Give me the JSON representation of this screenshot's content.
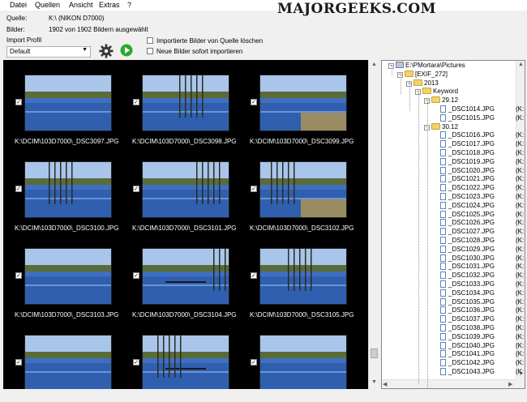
{
  "menu": [
    "Datei",
    "Quellen",
    "Ansicht",
    "Extras",
    "?"
  ],
  "watermark": "MAJORGEEKS.COM",
  "info": {
    "source_label": "Quelle:",
    "source_value": "K:\\ (NIKON D7000)",
    "images_label": "Bilder:",
    "images_value": "1902 von 1902 Bildern ausgewählt",
    "profile_label": "Import Profil",
    "profile_value": "Default"
  },
  "options": {
    "delete_label": "Importierte Bilder von Quelle löschen",
    "import_label": "Neue Bilder sofort importieren"
  },
  "thumbnails": [
    {
      "label": "K:\\DCIM\\103D7000\\_DSC3097.JPG",
      "checked": true
    },
    {
      "label": "K:\\DCIM\\103D7000\\_DSC3098.JPG",
      "checked": true
    },
    {
      "label": "K:\\DCIM\\103D7000\\_DSC3099.JPG",
      "checked": true
    },
    {
      "label": "K:\\DCIM\\103D7000\\_DSC3100.JPG",
      "checked": true
    },
    {
      "label": "K:\\DCIM\\103D7000\\_DSC3101.JPG",
      "checked": true
    },
    {
      "label": "K:\\DCIM\\103D7000\\_DSC3102.JPG",
      "checked": true
    },
    {
      "label": "K:\\DCIM\\103D7000\\_DSC3103.JPG",
      "checked": true
    },
    {
      "label": "K:\\DCIM\\103D7000\\_DSC3104.JPG",
      "checked": true
    },
    {
      "label": "K:\\DCIM\\103D7000\\_DSC3105.JPG",
      "checked": true
    },
    {
      "label": "",
      "checked": true
    },
    {
      "label": "",
      "checked": true
    },
    {
      "label": "",
      "checked": true
    }
  ],
  "tree": {
    "root": "E:\\PMortara\\Pictures",
    "exif": "[EXIF_272]",
    "year": "2013",
    "keyword": "Keyword",
    "date1": "29.12",
    "date2": "30.12",
    "files_date1": [
      "_DSC1014.JPG",
      "_DSC1015.JPG"
    ],
    "files_date2": [
      "_DSC1016.JPG",
      "_DSC1017.JPG",
      "_DSC1018.JPG",
      "_DSC1019.JPG",
      "_DSC1020.JPG",
      "_DSC1021.JPG",
      "_DSC1022.JPG",
      "_DSC1023.JPG",
      "_DSC1024.JPG",
      "_DSC1025.JPG",
      "_DSC1026.JPG",
      "_DSC1027.JPG",
      "_DSC1028.JPG",
      "_DSC1029.JPG",
      "_DSC1030.JPG",
      "_DSC1031.JPG",
      "_DSC1032.JPG",
      "_DSC1033.JPG",
      "_DSC1034.JPG",
      "_DSC1035.JPG",
      "_DSC1036.JPG",
      "_DSC1037.JPG",
      "_DSC1038.JPG",
      "_DSC1039.JPG",
      "_DSC1040.JPG",
      "_DSC1041.JPG",
      "_DSC1042.JPG",
      "_DSC1043.JPG",
      "_DSC1044.JPG"
    ],
    "suffix": "(K:"
  }
}
